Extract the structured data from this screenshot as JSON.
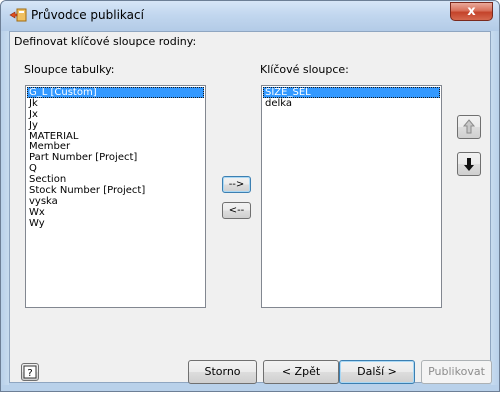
{
  "window": {
    "title": "Průvodce publikací",
    "close_label": "x"
  },
  "content": {
    "heading": "Definovat klíčové sloupce rodiny:",
    "left_label": "Sloupce tabulky:",
    "right_label": "Klíčové sloupce:",
    "table_columns": [
      "G_L [Custom]",
      "Jk",
      "Jx",
      "Jy",
      "MATERIAL",
      "Member",
      "Part Number [Project]",
      "Q",
      "Section",
      "Stock Number [Project]",
      "vyska",
      "Wx",
      "Wy"
    ],
    "key_columns": [
      "SIZE_SEL",
      "delka"
    ],
    "add_label": "-->",
    "remove_label": "<--"
  },
  "footer": {
    "help_label": "?",
    "storno_label": "Storno",
    "back_label": "< Zpět",
    "next_label": "Další >",
    "publish_label": "Publikovat"
  },
  "colors": {
    "selection": "#3399ff",
    "frame": "#b9d1ea",
    "client": "#f0f0f0"
  }
}
